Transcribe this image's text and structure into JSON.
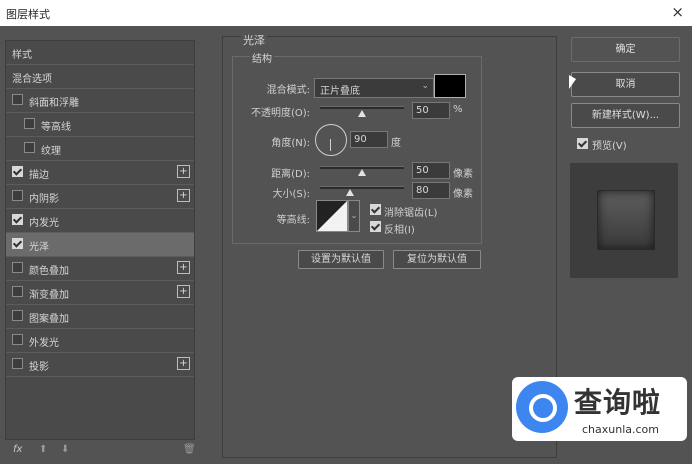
{
  "window": {
    "title": "图层样式",
    "close_glyph": "×"
  },
  "sidebar": {
    "items": [
      {
        "label": "样式",
        "checkbox": false,
        "checked": false,
        "plus": false,
        "indent": 0,
        "selected": false
      },
      {
        "label": "混合选项",
        "checkbox": false,
        "checked": false,
        "plus": false,
        "indent": 0,
        "selected": false
      },
      {
        "label": "斜面和浮雕",
        "checkbox": true,
        "checked": false,
        "plus": false,
        "indent": 0,
        "selected": false
      },
      {
        "label": "等高线",
        "checkbox": true,
        "checked": false,
        "plus": false,
        "indent": 1,
        "selected": false
      },
      {
        "label": "纹理",
        "checkbox": true,
        "checked": false,
        "plus": false,
        "indent": 1,
        "selected": false
      },
      {
        "label": "描边",
        "checkbox": true,
        "checked": true,
        "plus": true,
        "indent": 0,
        "selected": false
      },
      {
        "label": "内阴影",
        "checkbox": true,
        "checked": false,
        "plus": true,
        "indent": 0,
        "selected": false
      },
      {
        "label": "内发光",
        "checkbox": true,
        "checked": true,
        "plus": false,
        "indent": 0,
        "selected": false
      },
      {
        "label": "光泽",
        "checkbox": true,
        "checked": true,
        "plus": false,
        "indent": 0,
        "selected": true
      },
      {
        "label": "颜色叠加",
        "checkbox": true,
        "checked": false,
        "plus": true,
        "indent": 0,
        "selected": false
      },
      {
        "label": "渐变叠加",
        "checkbox": true,
        "checked": false,
        "plus": true,
        "indent": 0,
        "selected": false
      },
      {
        "label": "图案叠加",
        "checkbox": true,
        "checked": false,
        "plus": false,
        "indent": 0,
        "selected": false
      },
      {
        "label": "外发光",
        "checkbox": true,
        "checked": false,
        "plus": false,
        "indent": 0,
        "selected": false
      },
      {
        "label": "投影",
        "checkbox": true,
        "checked": false,
        "plus": true,
        "indent": 0,
        "selected": false
      }
    ],
    "footer": {
      "fx": "fx",
      "up": "⬆",
      "down": "⬇",
      "trash": "🗑"
    }
  },
  "panel": {
    "section_title": "光泽",
    "group_title": "结构",
    "blend_mode": {
      "label": "混合模式:",
      "value": "正片叠底",
      "color": "#000000"
    },
    "opacity": {
      "label": "不透明度(O):",
      "value": "50",
      "unit": "%",
      "level": 0.5
    },
    "angle": {
      "label": "角度(N):",
      "value": "90",
      "unit": "度"
    },
    "distance": {
      "label": "距离(D):",
      "value": "50",
      "unit": "像素",
      "level": 0.5
    },
    "size": {
      "label": "大小(S):",
      "value": "80",
      "unit": "像素",
      "level": 0.36
    },
    "contour": {
      "label": "等高线:",
      "antialias": {
        "label": "消除锯齿(L)",
        "checked": true
      },
      "invert": {
        "label": "反相(I)",
        "checked": true
      }
    },
    "buttons": {
      "set_default": "设置为默认值",
      "reset_default": "复位为默认值"
    }
  },
  "actions": {
    "ok": "确定",
    "cancel": "取消",
    "new_style": "新建样式(W)...",
    "preview": {
      "label": "预览(V)",
      "checked": true
    }
  },
  "watermark": {
    "cn": "查询啦",
    "en": "chaxunla.com"
  }
}
